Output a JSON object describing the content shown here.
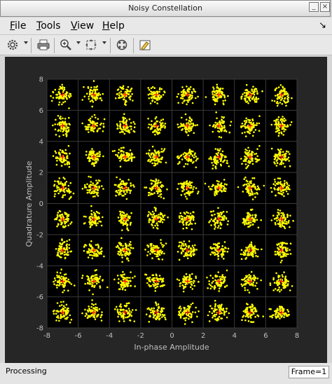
{
  "window": {
    "title": "Noisy Constellation"
  },
  "menu": {
    "items": [
      {
        "first": "F",
        "rest": "ile"
      },
      {
        "first": "T",
        "rest": "ools"
      },
      {
        "first": "V",
        "rest": "iew"
      },
      {
        "first": "H",
        "rest": "elp"
      }
    ]
  },
  "toolbar": {
    "icons": [
      "settings-icon",
      "print-icon",
      "zoom-in-icon",
      "fit-to-view-icon",
      "constellation-icon",
      "highlight-icon"
    ]
  },
  "status": {
    "text": "Processing",
    "frame": "Frame=1"
  },
  "colors": {
    "background": "#262626",
    "axes": "#000000",
    "points": "#ffff00",
    "reference": "#ff0000",
    "axis_text": "#bfbfbf"
  },
  "chart_data": {
    "type": "scatter",
    "title": "",
    "xlabel": "In-phase Amplitude",
    "ylabel": "Quadrature Amplitude",
    "xlim": [
      -8,
      8
    ],
    "ylim": [
      -8,
      8
    ],
    "xticks": [
      -8,
      -6,
      -4,
      -2,
      0,
      2,
      4,
      6,
      8
    ],
    "yticks": [
      -8,
      -6,
      -4,
      -2,
      0,
      2,
      4,
      6,
      8
    ],
    "grid": true,
    "reference_points": {
      "i_levels": [
        -7,
        -5,
        -3,
        -1,
        1,
        3,
        5,
        7
      ],
      "q_levels": [
        -7,
        -5,
        -3,
        -1,
        1,
        3,
        5,
        7
      ],
      "marker": "+"
    },
    "noise_spread": 0.55,
    "points_per_symbol": 70
  }
}
